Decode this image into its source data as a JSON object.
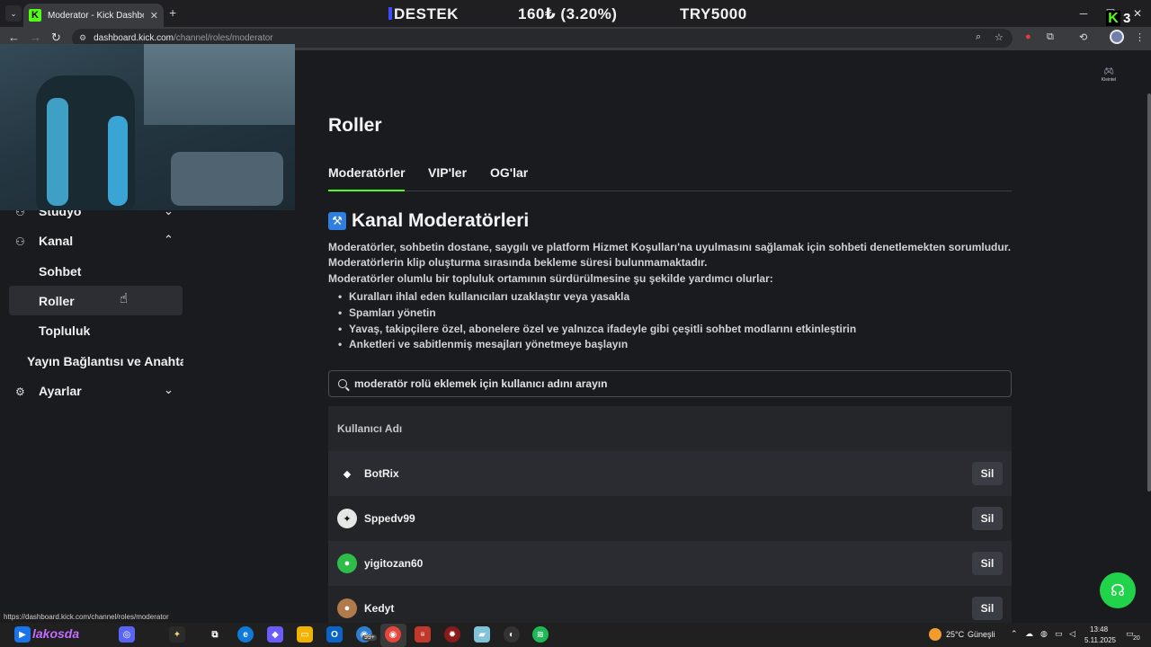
{
  "browser": {
    "tab_title": "Moderator - Kick Dashboard",
    "tab_close": "✕",
    "new_tab": "+",
    "url_host": "dashboard.kick.com",
    "url_path": "/channel/roles/moderator",
    "status_url": "https://dashboard.kick.com/channel/roles/moderator"
  },
  "overlay": {
    "ticker_1": "DESTEK",
    "ticker_2": "160₺ (3.20%)",
    "ticker_3": "TRY5000",
    "k_logo": "K",
    "k_count": "3",
    "bot_label": "Kleintel"
  },
  "sidebar": {
    "studio": "Stüdyo",
    "kanal": "Kanal",
    "sohbet": "Sohbet",
    "roller": "Roller",
    "topluluk": "Topluluk",
    "baglanti": "Yayın Bağlantısı ve Anahtar",
    "ayarlar": "Ayarlar"
  },
  "main": {
    "title": "Roller",
    "tabs": [
      "Moderatörler",
      "VIP'ler",
      "OG'lar"
    ],
    "section_title": "Kanal Moderatörleri",
    "desc_lines": [
      "Moderatörler, sohbetin dostane, saygılı ve platform Hizmet Koşulları'na uyulmasını sağlamak için sohbeti denetlemekten sorumludur.",
      "Moderatörlerin klip oluşturma sırasında bekleme süresi bulunmamaktadır.",
      "Moderatörler olumlu bir topluluk ortamının sürdürülmesine şu şekilde yardımcı olurlar:"
    ],
    "bullets": [
      "Kuralları ihlal eden kullanıcıları uzaklaştır veya yasakla",
      "Spamları yönetin",
      "Yavaş, takipçilere özel, abonelere özel ve yalnızca ifadeyle gibi çeşitli sohbet modlarını etkinleştirin",
      "Anketleri ve sabitlenmiş mesajları yönetmeye başlayın"
    ],
    "search_placeholder": "moderatör rolü eklemek için kullanıcı adını arayın",
    "table_header": "Kullanıcı Adı",
    "remove_label": "Sil",
    "moderators": [
      "BotRix",
      "Sppedv99",
      "yigitozan60",
      "Kedyt"
    ]
  },
  "taskbar": {
    "brand": "lakosda",
    "weather_temp": "25°C",
    "weather_desc": "Güneşli",
    "time": "13:48",
    "date": "5.11.2025",
    "notif": "20",
    "badge_count": "99+"
  },
  "colors": {
    "kick_green": "#53fc18",
    "bg": "#191b1f",
    "help_green": "#20d34a"
  }
}
